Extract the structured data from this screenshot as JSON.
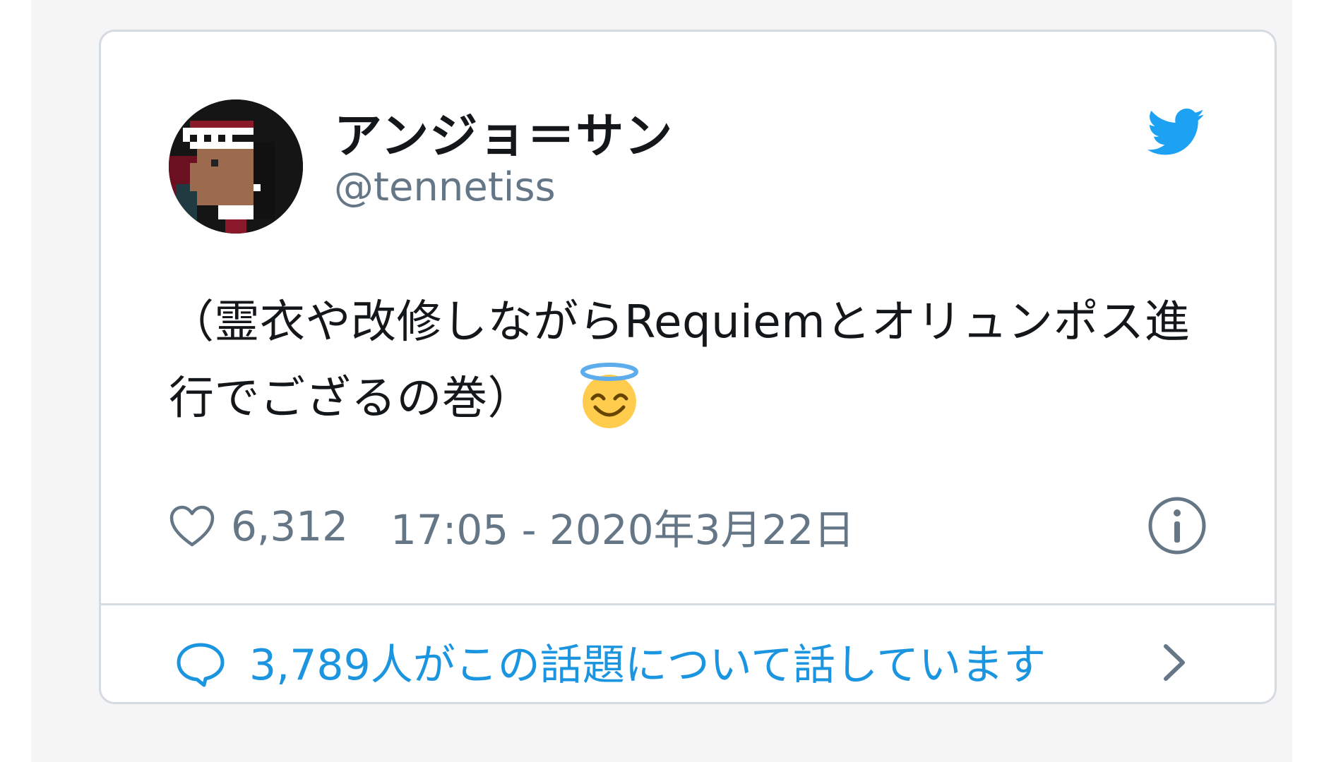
{
  "tweet": {
    "display_name": "アンジョ＝サン",
    "handle": "@tennetiss",
    "text": "（霊衣や改修しながらRequiemとオリュンポス進行でござるの巻）",
    "emoji": "smiling-face-with-halo-icon",
    "likes": "6,312",
    "timestamp": "17:05 - 2020年3月22日"
  },
  "conversation": {
    "label": "3,789人がこの話題について話しています"
  },
  "icons": {
    "logo": "twitter-bird-icon",
    "like": "heart-icon",
    "info": "info-icon",
    "reply": "speech-bubble-icon",
    "more": "chevron-right-icon"
  },
  "colors": {
    "twitter_blue": "#1da1f2",
    "link_blue": "#1b95e0",
    "secondary_text": "#657786",
    "primary_text": "#14171a",
    "border": "#d5dbe1"
  }
}
